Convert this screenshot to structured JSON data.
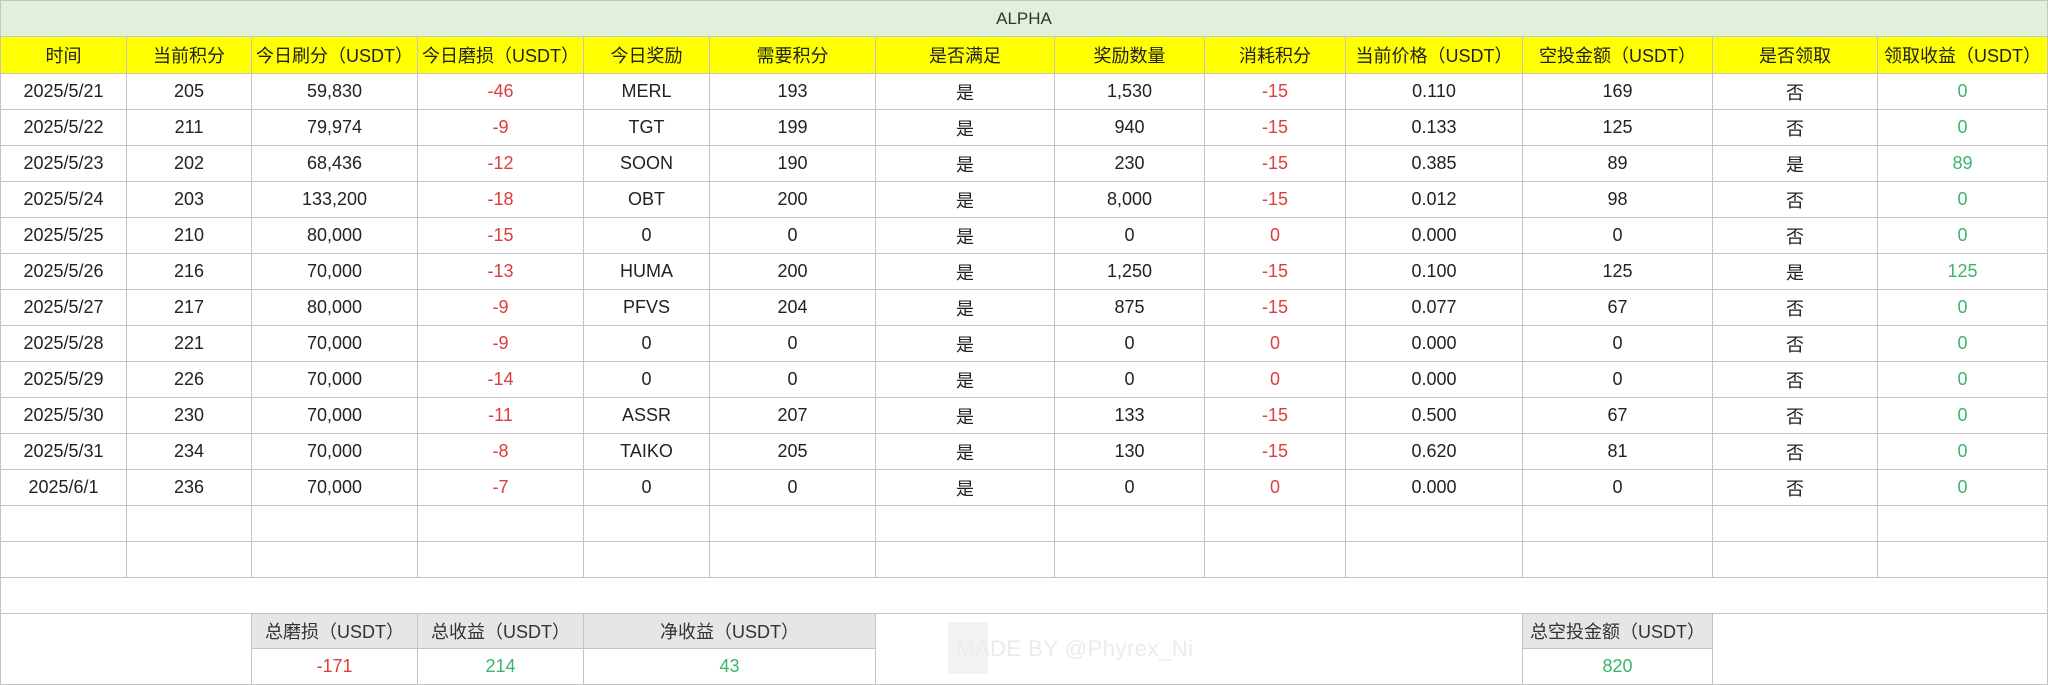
{
  "title": "ALPHA",
  "headers": [
    "时间",
    "当前积分",
    "今日刷分（USDT）",
    "今日磨损（USDT）",
    "今日奖励",
    "需要积分",
    "是否满足",
    "奖励数量",
    "消耗积分",
    "当前价格（USDT）",
    "空投金额（USDT）",
    "是否领取",
    "领取收益（USDT）"
  ],
  "rows": [
    [
      "2025/5/21",
      "205",
      "59,830",
      "-46",
      "MERL",
      "193",
      "是",
      "1,530",
      "-15",
      "0.110",
      "169",
      "否",
      "0"
    ],
    [
      "2025/5/22",
      "211",
      "79,974",
      "-9",
      "TGT",
      "199",
      "是",
      "940",
      "-15",
      "0.133",
      "125",
      "否",
      "0"
    ],
    [
      "2025/5/23",
      "202",
      "68,436",
      "-12",
      "SOON",
      "190",
      "是",
      "230",
      "-15",
      "0.385",
      "89",
      "是",
      "89"
    ],
    [
      "2025/5/24",
      "203",
      "133,200",
      "-18",
      "OBT",
      "200",
      "是",
      "8,000",
      "-15",
      "0.012",
      "98",
      "否",
      "0"
    ],
    [
      "2025/5/25",
      "210",
      "80,000",
      "-15",
      "0",
      "0",
      "是",
      "0",
      "0",
      "0.000",
      "0",
      "否",
      "0"
    ],
    [
      "2025/5/26",
      "216",
      "70,000",
      "-13",
      "HUMA",
      "200",
      "是",
      "1,250",
      "-15",
      "0.100",
      "125",
      "是",
      "125"
    ],
    [
      "2025/5/27",
      "217",
      "80,000",
      "-9",
      "PFVS",
      "204",
      "是",
      "875",
      "-15",
      "0.077",
      "67",
      "否",
      "0"
    ],
    [
      "2025/5/28",
      "221",
      "70,000",
      "-9",
      "0",
      "0",
      "是",
      "0",
      "0",
      "0.000",
      "0",
      "否",
      "0"
    ],
    [
      "2025/5/29",
      "226",
      "70,000",
      "-14",
      "0",
      "0",
      "是",
      "0",
      "0",
      "0.000",
      "0",
      "否",
      "0"
    ],
    [
      "2025/5/30",
      "230",
      "70,000",
      "-11",
      "ASSR",
      "207",
      "是",
      "133",
      "-15",
      "0.500",
      "67",
      "否",
      "0"
    ],
    [
      "2025/5/31",
      "234",
      "70,000",
      "-8",
      "TAIKO",
      "205",
      "是",
      "130",
      "-15",
      "0.620",
      "81",
      "否",
      "0"
    ],
    [
      "2025/6/1",
      "236",
      "70,000",
      "-7",
      "0",
      "0",
      "是",
      "0",
      "0",
      "0.000",
      "0",
      "否",
      "0"
    ]
  ],
  "summary": {
    "total_loss_label": "总磨损（USDT）",
    "total_loss_value": "-171",
    "total_income_label": "总收益（USDT）",
    "total_income_value": "214",
    "net_income_label": "净收益（USDT）",
    "net_income_value": "43",
    "total_airdrop_label": "总空投金额（USDT）",
    "total_airdrop_value": "820"
  },
  "watermark": "MADE BY @Phyrex_Ni",
  "colors": {
    "title_bg": "#e2efda",
    "header_bg": "#ffff00",
    "negative": "#e03c3c",
    "positive": "#3cb46e",
    "summary_label_bg": "#e7e6e6",
    "grid": "#c4c4c4"
  }
}
